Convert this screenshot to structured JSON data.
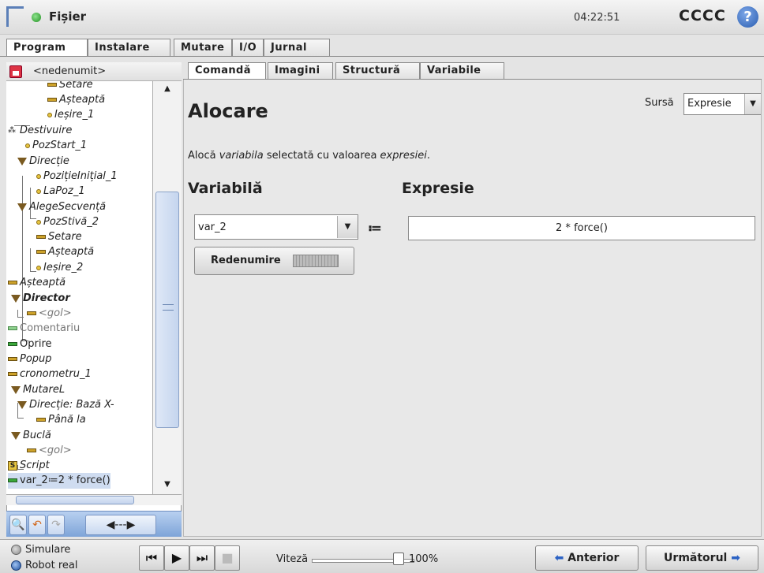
{
  "header": {
    "file_menu": "Fișier",
    "clock": "04:22:51",
    "robot_name": "CCCC",
    "help": "?"
  },
  "main_tabs": [
    "Program",
    "Instalare",
    "Mutare",
    "I/O",
    "Jurnal"
  ],
  "program_name": "<nedenumit>",
  "tree": [
    {
      "label": "Setare",
      "type": "set"
    },
    {
      "label": "Așteaptă",
      "type": "wait"
    },
    {
      "label": "Ieșire_1",
      "type": "out"
    },
    {
      "label": "Destivuire",
      "type": "pal"
    },
    {
      "label": "PozStart_1",
      "type": "out"
    },
    {
      "label": "Direcție",
      "type": "fold"
    },
    {
      "label": "PozițieInițial_1",
      "type": "out"
    },
    {
      "label": "LaPoz_1",
      "type": "out"
    },
    {
      "label": "AlegeSecvență",
      "type": "fold"
    },
    {
      "label": "PozStivă_2",
      "type": "out"
    },
    {
      "label": "Setare",
      "type": "set"
    },
    {
      "label": "Așteaptă",
      "type": "wait"
    },
    {
      "label": "Ieșire_2",
      "type": "out"
    },
    {
      "label": "Așteaptă",
      "type": "wait"
    },
    {
      "label": "Director",
      "type": "fold"
    },
    {
      "label": "<gol>",
      "type": "set"
    },
    {
      "label": "Comentariu",
      "type": "gray"
    },
    {
      "label": "Oprire",
      "type": "stop"
    },
    {
      "label": "Popup",
      "type": "wait"
    },
    {
      "label": "cronometru_1",
      "type": "wait"
    },
    {
      "label": "MutareL",
      "type": "fold"
    },
    {
      "label": "Direcție: Bază X-",
      "type": "fold"
    },
    {
      "label": "Până la",
      "type": "set"
    },
    {
      "label": "Buclă",
      "type": "fold"
    },
    {
      "label": "<gol>",
      "type": "set"
    },
    {
      "label": "Script",
      "type": "script"
    },
    {
      "label": "var_2≔2 * force()",
      "type": "stop"
    }
  ],
  "sub_tabs": [
    "Comandă",
    "Imagini",
    "Structură",
    "Variabile"
  ],
  "panel": {
    "title": "Alocare",
    "source_label": "Sursă",
    "source_value": "Expresie",
    "description_prefix": "Alocă ",
    "description_var": "variabila",
    "description_middle": " selectată cu valoarea ",
    "description_expr": "expresiei",
    "description_suffix": ".",
    "variable_heading": "Variabilă",
    "expression_heading": "Expresie",
    "variable_value": "var_2",
    "assign_symbol": "≔",
    "expression_value": "2 * force()",
    "rename_label": "Redenumire"
  },
  "bottom": {
    "simulation": "Simulare",
    "real_robot": "Robot real",
    "speed_label": "Viteză",
    "speed_value": "100%",
    "speed_fraction": 1.0,
    "prev": "Anterior",
    "next": "Următorul"
  }
}
